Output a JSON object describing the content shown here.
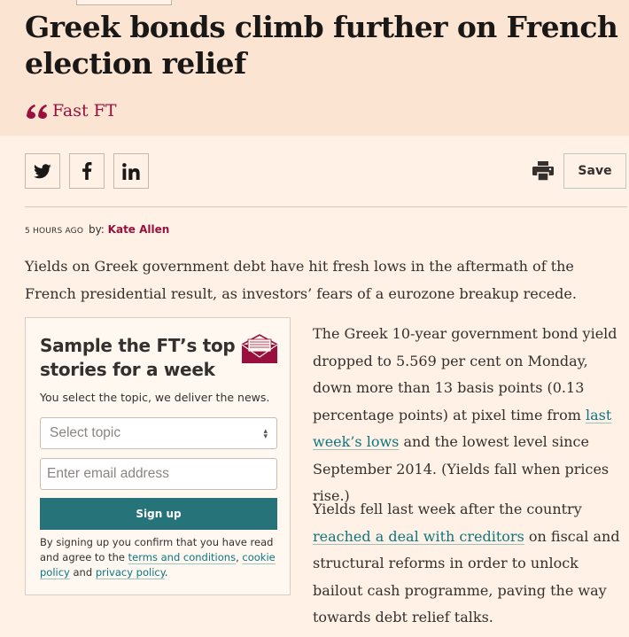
{
  "article": {
    "headline": "Greek bonds climb further on French election relief",
    "section": "Fast FT",
    "time": "5 HOURS AGO",
    "by": "by:",
    "author": "Kate Allen"
  },
  "toolbar": {
    "save_label": "Save",
    "icons": [
      "twitter-icon",
      "facebook-icon",
      "linkedin-icon",
      "print-icon"
    ]
  },
  "body": {
    "lead": "Yields on Greek government debt have hit fresh lows in the aftermath of the French presidential result, as investors’ fears of a eurozone breakup recede.",
    "p2_a": "The Greek 10-year government bond yield dropped to 5.569 per cent on Monday, down more than 13 basis points (0.13 percentage points) at pixel time from ",
    "p2_link": "last week’s lows",
    "p2_b": " and the lowest level since September 2014. (Yields fall when prices rise.)",
    "p3_a": "Yields fell last week after the country ",
    "p3_link": "reached a deal with creditors",
    "p3_b": " on fiscal and structural reforms in order to unlock bailout cash programme, paving the way towards debt relief talks."
  },
  "promo": {
    "title": "Sample the FT’s top stories for a week",
    "subtitle": "You select the topic, we deliver the news.",
    "select_value": "Select topic",
    "email_placeholder": "Enter email address",
    "signup_label": "Sign up",
    "legal_a": "By signing up you confirm that you have read and agree to the ",
    "legal_terms": "terms and conditions",
    "legal_sep": ", ",
    "legal_cookie": "cookie policy",
    "legal_and": " and ",
    "legal_privacy": "privacy policy",
    "legal_end": "."
  },
  "colors": {
    "background": "#fff1e5",
    "header_band": "#fbe4d2",
    "brand_claret": "#990f3d",
    "link_teal": "#0d7680",
    "button_teal": "#26747a"
  }
}
